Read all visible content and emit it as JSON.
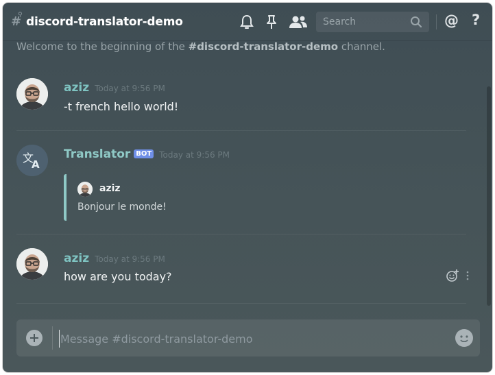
{
  "header": {
    "channel_name": "discord-translator-demo",
    "search_placeholder": "Search",
    "at_label": "@",
    "help_label": "?"
  },
  "welcome": {
    "prefix": "Welcome to the beginning of the ",
    "channel": "#discord-translator-demo",
    "suffix": " channel."
  },
  "messages": [
    {
      "author": "aziz",
      "timestamp": "Today at 9:56 PM",
      "text": "-t french hello world!"
    },
    {
      "author": "Translator",
      "badge": "BOT",
      "timestamp": "Today at 9:56 PM",
      "embed": {
        "author": "aziz",
        "text": "Bonjour le monde!"
      }
    },
    {
      "author": "aziz",
      "timestamp": "Today at 9:56 PM",
      "text": "how are you today?"
    }
  ],
  "composer": {
    "placeholder": "Message #discord-translator-demo"
  },
  "colors": {
    "accent": "#7fc4c2",
    "bot_badge": "#6f8fe8",
    "embed_border": "#8fc9c6"
  }
}
